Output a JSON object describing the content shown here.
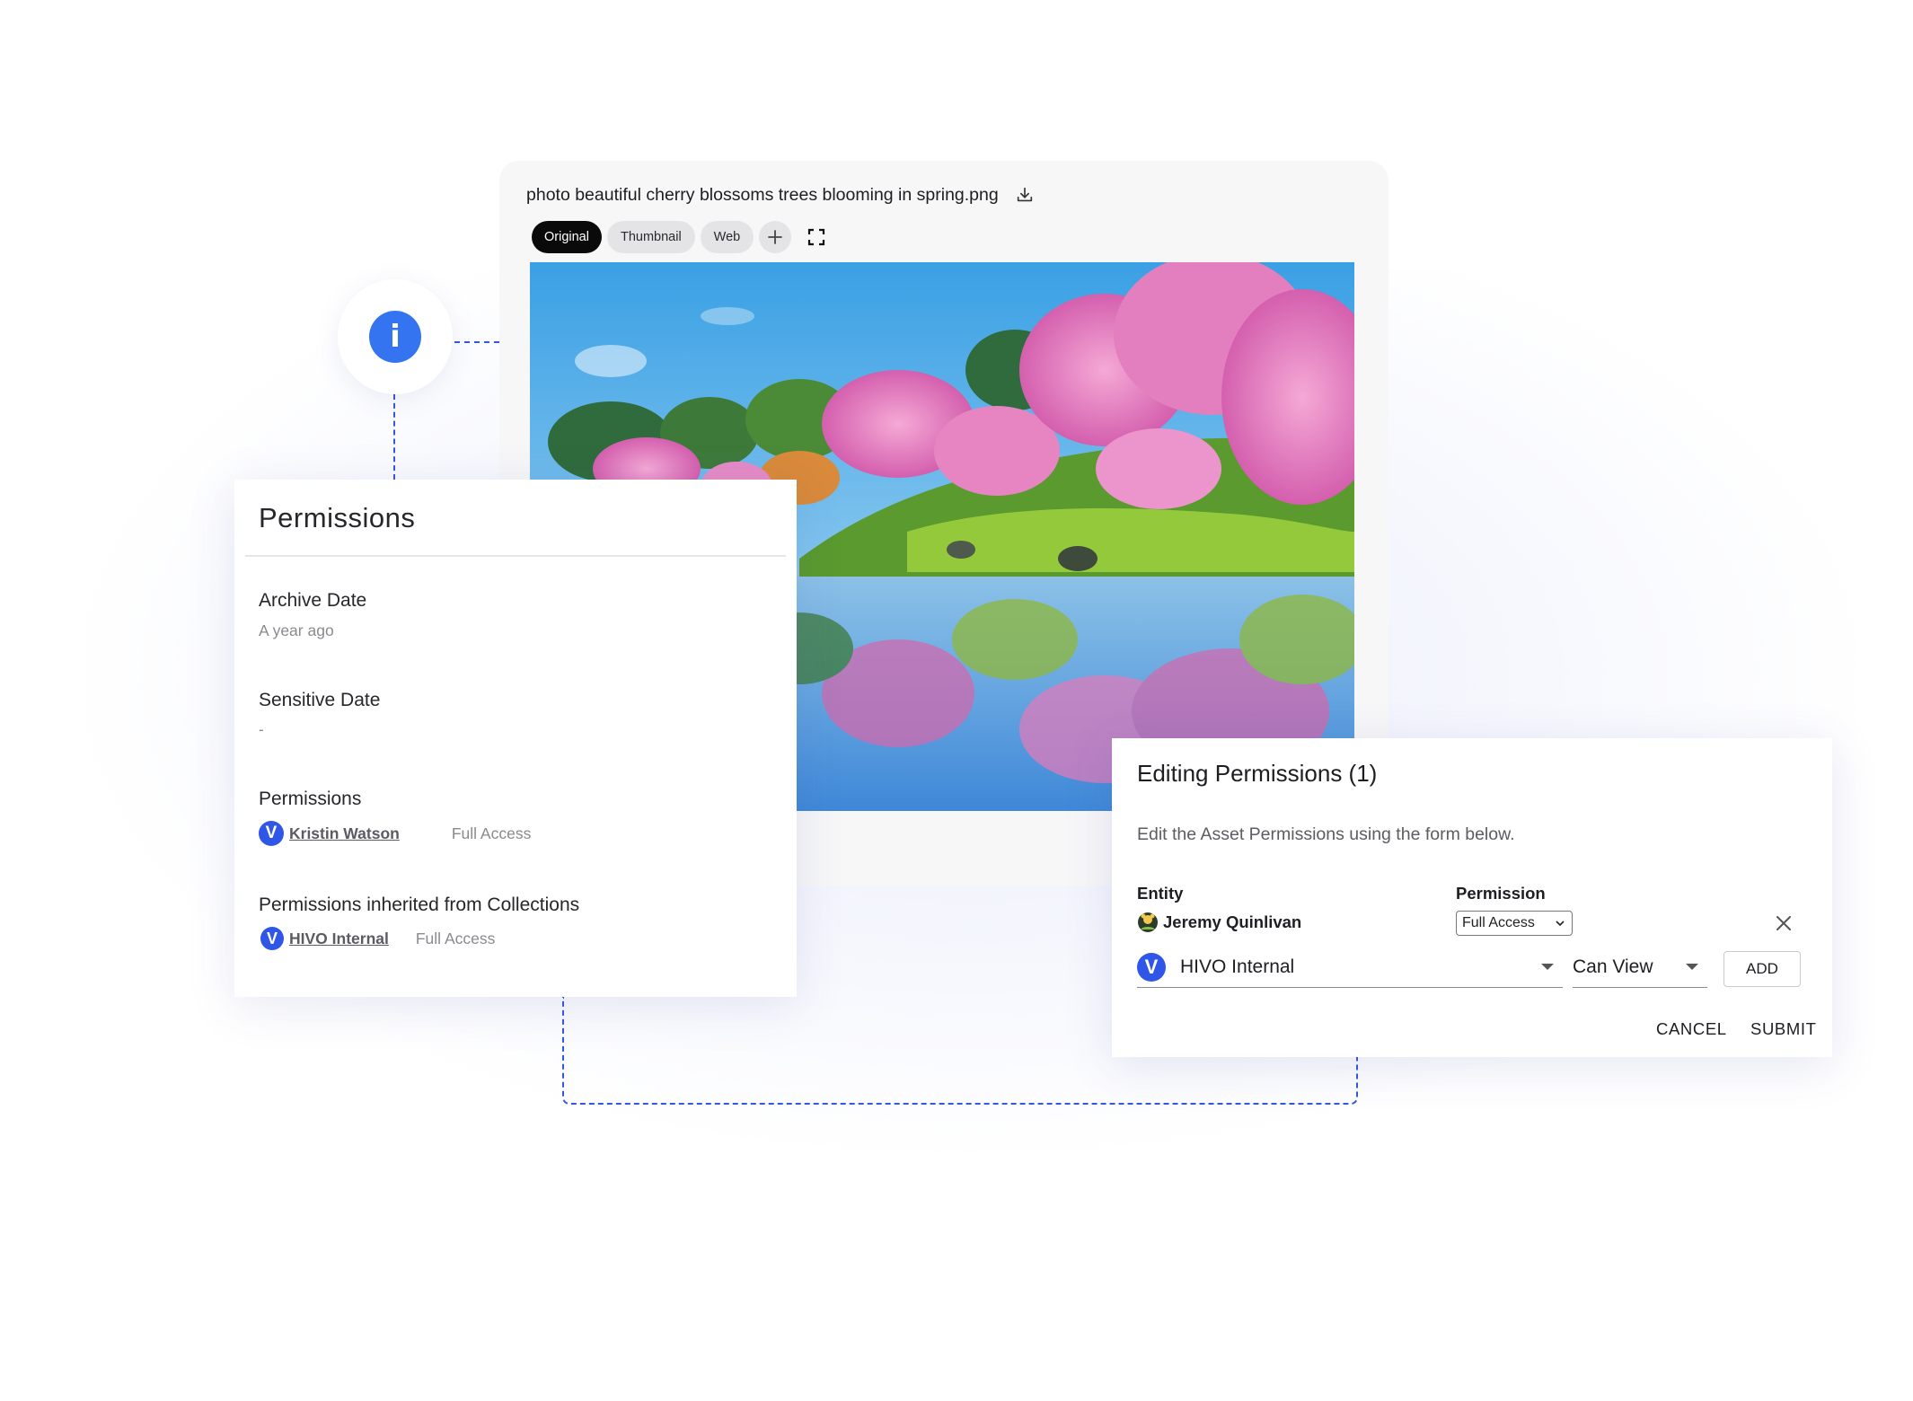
{
  "asset": {
    "file_name": "photo beautiful cherry blossoms trees blooming in spring.png",
    "tabs": [
      "Original",
      "Thumbnail",
      "Web"
    ],
    "active_tab": "Original"
  },
  "permissions_panel": {
    "title": "Permissions",
    "archive_date_label": "Archive Date",
    "archive_date_value": "A year ago",
    "sensitive_date_label": "Sensitive Date",
    "sensitive_date_value": "-",
    "permissions_label": "Permissions",
    "permission_user": "Kristin Watson",
    "permission_user_access": "Full Access",
    "inherited_label": "Permissions inherited from Collections",
    "inherited_entity": "HIVO Internal",
    "inherited_access": "Full Access",
    "logo_letter": "V"
  },
  "edit_dialog": {
    "title": "Editing Permissions (1)",
    "description": "Edit the Asset Permissions using the form below.",
    "entity_label": "Entity",
    "permission_label": "Permission",
    "existing_entity": "Jeremy Quinlivan",
    "existing_permission": "Full Access",
    "new_entity": "HIVO Internal",
    "new_permission": "Can View",
    "add_label": "ADD",
    "cancel_label": "CANCEL",
    "submit_label": "SUBMIT"
  },
  "icons": {
    "info": "info-icon",
    "download": "download-icon",
    "add": "plus-icon",
    "fullscreen": "fullscreen-icon",
    "close": "close-icon"
  },
  "colors": {
    "accent": "#3574f0",
    "logo_blue": "#2f56e6",
    "dashed_line": "#3457e0"
  }
}
